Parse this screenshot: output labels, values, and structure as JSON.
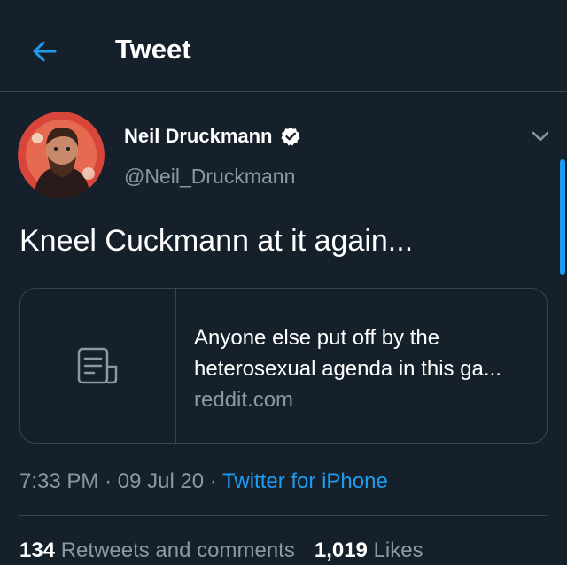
{
  "header": {
    "back_icon": "arrow-left-icon",
    "title": "Tweet"
  },
  "tweet": {
    "author": {
      "display_name": "Neil Druckmann",
      "handle": "@Neil_Druckmann",
      "verified": true,
      "verified_icon": "verified-badge-icon",
      "avatar_icon": "avatar-illustration"
    },
    "more_icon": "chevron-down-icon",
    "text": "Kneel Cuckmann at it again...",
    "link_card": {
      "thumb_icon": "document-icon",
      "title_line1": "Anyone else put off by the",
      "title_line2": "heterosexual agenda in this ga...",
      "domain": "reddit.com"
    },
    "time": "7:33 PM",
    "date": "09 Jul 20",
    "separator": "·",
    "source": "Twitter for iPhone",
    "stats": {
      "retweets_count": "134",
      "retweets_label": "Retweets and comments",
      "likes_count": "1,019",
      "likes_label": "Likes"
    }
  },
  "colors": {
    "background": "#15202b",
    "accent": "#1d9bf0",
    "secondary_text": "#8899a6",
    "border": "#38444d"
  }
}
